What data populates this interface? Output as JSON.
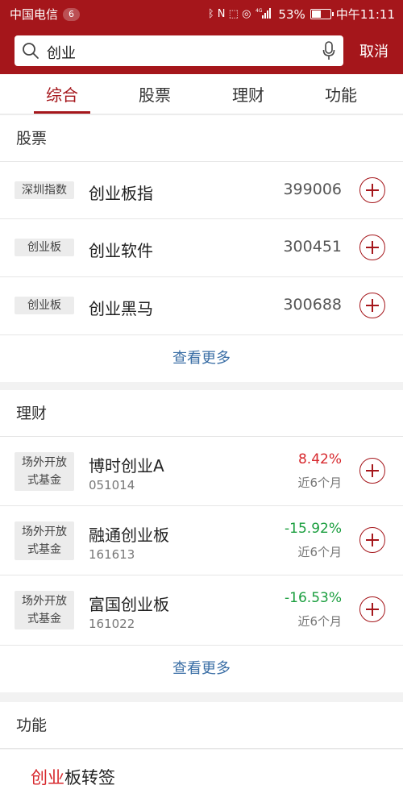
{
  "status": {
    "carrier": "中国电信",
    "notif_count": "6",
    "icons_text": "ᛒ N ⬚ ◎",
    "network": "4G",
    "battery": "53%",
    "battery_level": 0.53,
    "time": "中午11:11"
  },
  "search": {
    "query": "创业",
    "cancel_label": "取消"
  },
  "tabs": [
    {
      "label": "综合",
      "active": true
    },
    {
      "label": "股票",
      "active": false
    },
    {
      "label": "理财",
      "active": false
    },
    {
      "label": "功能",
      "active": false
    }
  ],
  "stocks": {
    "title": "股票",
    "items": [
      {
        "tag": "深圳指数",
        "name": "创业板指",
        "code": "399006"
      },
      {
        "tag": "创业板",
        "name": "创业软件",
        "code": "300451"
      },
      {
        "tag": "创业板",
        "name": "创业黑马",
        "code": "300688"
      }
    ],
    "more_label": "查看更多"
  },
  "funds": {
    "title": "理财",
    "items": [
      {
        "tag_line1": "场外开放",
        "tag_line2": "式基金",
        "name": "博时创业A",
        "code": "051014",
        "pct": "8.42%",
        "direction": "up",
        "period": "近6个月"
      },
      {
        "tag_line1": "场外开放",
        "tag_line2": "式基金",
        "name": "融通创业板",
        "code": "161613",
        "pct": "-15.92%",
        "direction": "down",
        "period": "近6个月"
      },
      {
        "tag_line1": "场外开放",
        "tag_line2": "式基金",
        "name": "富国创业板",
        "code": "161022",
        "pct": "-16.53%",
        "direction": "down",
        "period": "近6个月"
      }
    ],
    "more_label": "查看更多"
  },
  "functions": {
    "title": "功能",
    "item_highlight": "创业",
    "item_rest": "板转签"
  },
  "colors": {
    "brand": "#a5161b",
    "up": "#d7282d",
    "down": "#1a9e3e",
    "link": "#3a6ea5"
  }
}
